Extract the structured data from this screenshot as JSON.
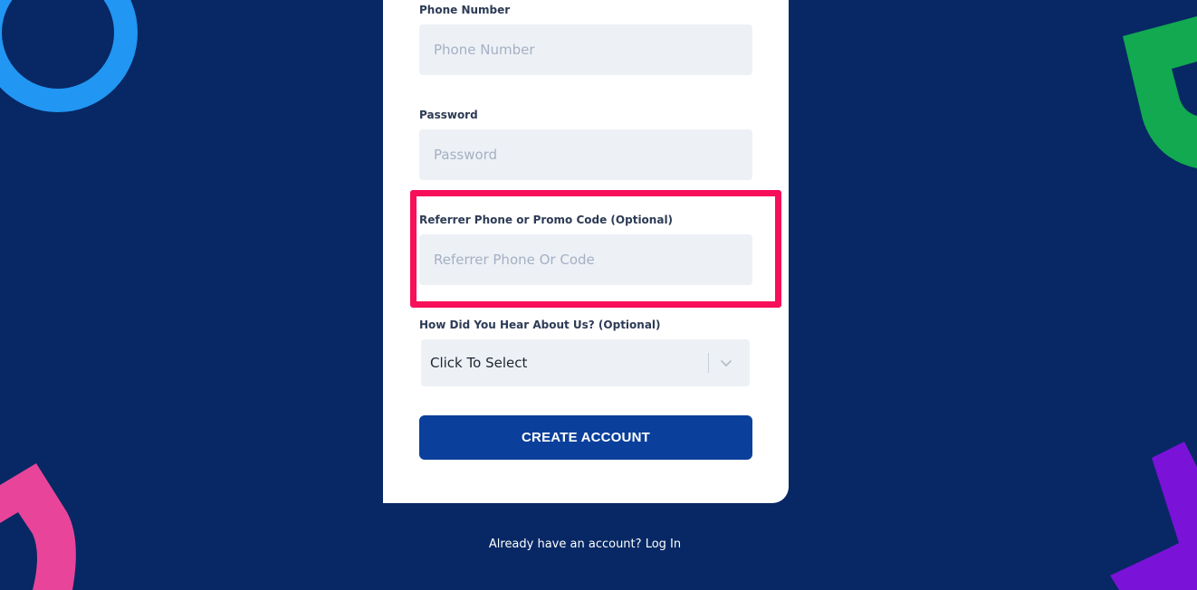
{
  "form": {
    "phone": {
      "label": "Phone Number",
      "placeholder": "Phone Number",
      "value": ""
    },
    "password": {
      "label": "Password",
      "placeholder": "Password",
      "value": ""
    },
    "referrer": {
      "label": "Referrer Phone or Promo Code (Optional)",
      "placeholder": "Referrer Phone Or Code",
      "value": ""
    },
    "source": {
      "label": "How Did You Hear About Us? (Optional)",
      "selected": "Click To Select"
    },
    "submit_label": "CREATE ACCOUNT"
  },
  "footer": {
    "prompt": "Already have an account?",
    "login_label": "Log In"
  },
  "colors": {
    "background": "#072864",
    "card": "#ffffff",
    "input_bg": "#edf1f6",
    "button": "#0a3f9b",
    "highlight": "#f70f5a",
    "deco_blue": "#2196f3",
    "deco_green": "#12a951",
    "deco_pink": "#e8459a",
    "deco_purple": "#7a12d8"
  }
}
